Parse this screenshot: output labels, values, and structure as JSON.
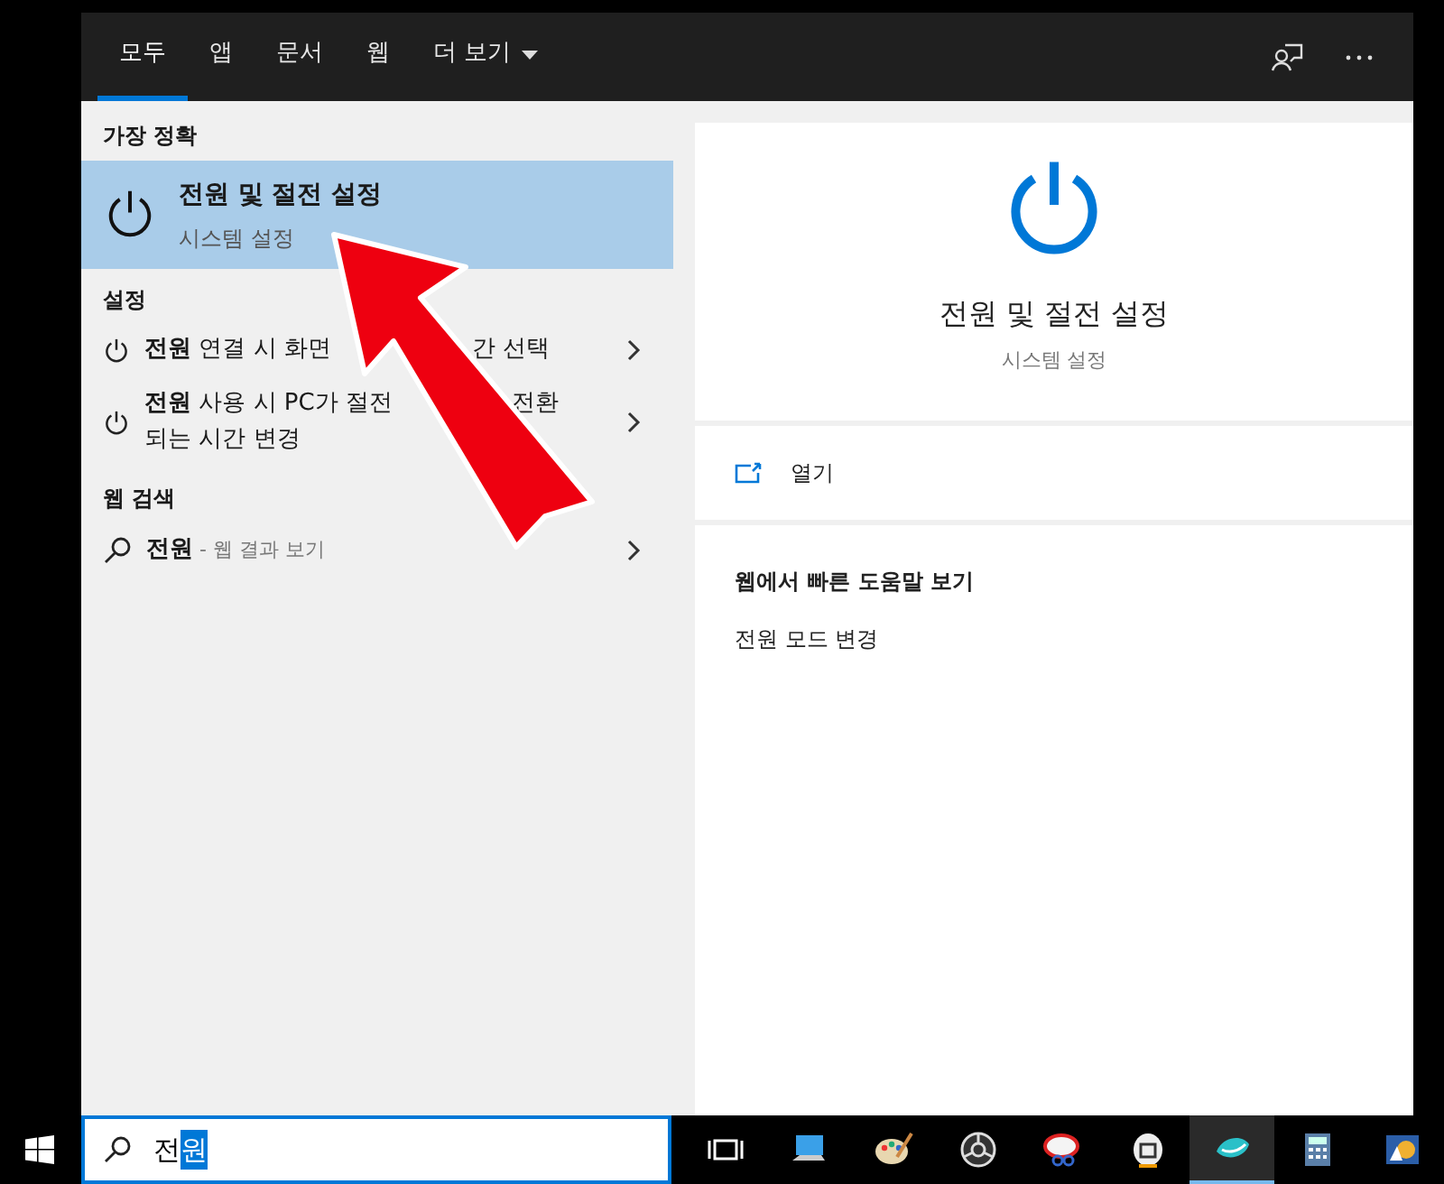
{
  "tabs": [
    {
      "label": "모두",
      "selected": true
    },
    {
      "label": "앱",
      "selected": false
    },
    {
      "label": "문서",
      "selected": false
    },
    {
      "label": "웹",
      "selected": false
    },
    {
      "label": "더 보기",
      "selected": false,
      "dropdown": true
    }
  ],
  "best_match": {
    "heading": "가장 정확",
    "title": "전원 및 절전 설정",
    "subtitle": "시스템 설정",
    "selected": true
  },
  "settings": {
    "heading": "설정",
    "items": [
      {
        "lines": [
          [
            "**전원** 연결 시 화면",
            "간 선택"
          ]
        ]
      },
      {
        "lines": [
          [
            "**전원** 사용 시 PC가 절전",
            "전환"
          ],
          [
            "되는 시간 변경"
          ]
        ]
      }
    ]
  },
  "web_search": {
    "heading": "웹 검색",
    "query": "전원",
    "suffix": " - 웹 결과 보기"
  },
  "preview": {
    "title": "전원 및 절전 설정",
    "subtitle": "시스템 설정",
    "open": "열기",
    "help_heading": "웹에서 빠른 도움말 보기",
    "help_links": [
      "전원 모드 변경"
    ]
  },
  "search": {
    "typed": "전",
    "composing": "원"
  }
}
